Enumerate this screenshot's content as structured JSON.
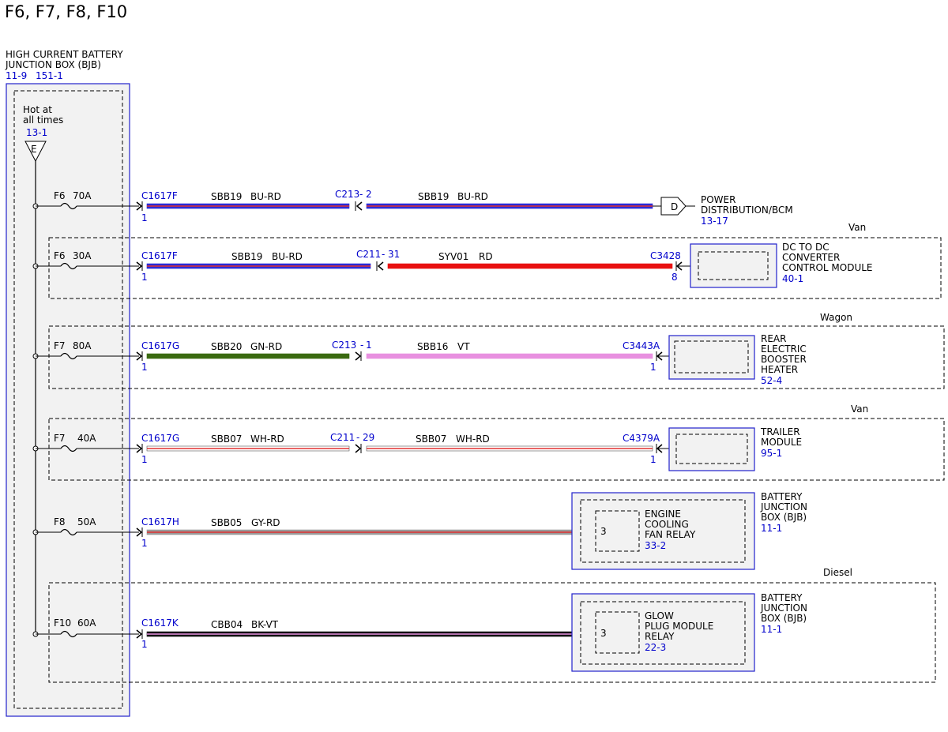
{
  "title": "F6, F7, F8, F10",
  "bjb": {
    "name_line1": "HIGH CURRENT BATTERY",
    "name_line2": "JUNCTION BOX (BJB)",
    "ref1": "11-9",
    "ref2": "151-1",
    "hot_line1": "Hot at",
    "hot_line2": "all times",
    "hot_ref": "13-1",
    "hot_terminal": "E"
  },
  "circuits": [
    {
      "fuse": "F6",
      "amps": "70A",
      "variant": "",
      "connector": "C1617F",
      "connector_pin": "1",
      "circuit1": "SBB19",
      "color1": "BU-RD",
      "inline": "C213",
      "inline_pin": "2",
      "circuit2": "SBB19",
      "color2": "BU-RD",
      "end_terminal": "D",
      "dest_lines": [
        "POWER",
        "DISTRIBUTION/BCM"
      ],
      "dest_ref": "13-17"
    },
    {
      "fuse": "F6",
      "amps": "30A",
      "variant": "Van",
      "connector": "C1617F",
      "connector_pin": "1",
      "circuit1": "SBB19",
      "color1": "BU-RD",
      "inline": "C211",
      "inline_pin": "31",
      "circuit2": "SYV01",
      "color2": "RD",
      "end_connector": "C3428",
      "end_pin": "8",
      "dest_lines": [
        "DC TO DC",
        "CONVERTER",
        "CONTROL MODULE"
      ],
      "dest_ref": "40-1"
    },
    {
      "fuse": "F7",
      "amps": "80A",
      "variant": "Wagon",
      "connector": "C1617G",
      "connector_pin": "1",
      "circuit1": "SBB20",
      "color1": "GN-RD",
      "inline": "C213",
      "inline_pin": "1",
      "circuit2": "SBB16",
      "color2": "VT",
      "end_connector": "C3443A",
      "end_pin": "1",
      "dest_lines": [
        "REAR",
        "ELECTRIC",
        "BOOSTER",
        "HEATER"
      ],
      "dest_ref": "52-4"
    },
    {
      "fuse": "F7",
      "amps": "40A",
      "variant": "Van",
      "connector": "C1617G",
      "connector_pin": "1",
      "circuit1": "SBB07",
      "color1": "WH-RD",
      "inline": "C211",
      "inline_pin": "29",
      "circuit2": "SBB07",
      "color2": "WH-RD",
      "end_connector": "C4379A",
      "end_pin": "1",
      "dest_lines": [
        "TRAILER",
        "MODULE"
      ],
      "dest_ref": "95-1"
    },
    {
      "fuse": "F8",
      "amps": "50A",
      "variant": "",
      "connector": "C1617H",
      "connector_pin": "1",
      "circuit1": "SBB05",
      "color1": "GY-RD",
      "relay_pin": "3",
      "relay_lines": [
        "ENGINE",
        "COOLING",
        "FAN RELAY"
      ],
      "relay_ref": "33-2",
      "box_lines": [
        "BATTERY",
        "JUNCTION",
        "BOX (BJB)"
      ],
      "box_ref": "11-1"
    },
    {
      "fuse": "F10",
      "amps": "60A",
      "variant": "Diesel",
      "connector": "C1617K",
      "connector_pin": "1",
      "circuit1": "CBB04",
      "color1": "BK-VT",
      "relay_pin": "3",
      "relay_lines": [
        "GLOW",
        "PLUG MODULE",
        "RELAY"
      ],
      "relay_ref": "22-3",
      "box_lines": [
        "BATTERY",
        "JUNCTION",
        "BOX (BJB)"
      ],
      "box_ref": "11-1"
    }
  ],
  "colors": {
    "blue_wire": "#2a2ad8",
    "red_stripe": "#e03030",
    "red_wire": "#e81010",
    "green_wire": "#3a6a10",
    "violet_wire": "#e890e0",
    "white_wire": "#ffffff",
    "gray_wire": "#9a9a9a",
    "black_wire": "#111111",
    "component_border": "#2222cc",
    "ref_text": "#0000cc",
    "box_fill": "#f2f2f2"
  }
}
